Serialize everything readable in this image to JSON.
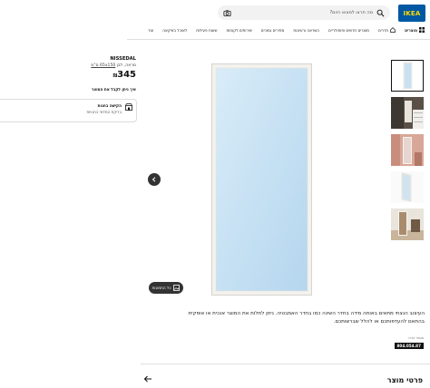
{
  "header": {
    "logo_text": "ΙΚΕΑ",
    "search_placeholder": "מה תרצו למצוא היום?",
    "nav": [
      {
        "label": "מוצרים",
        "icon": "grid-icon"
      },
      {
        "label": "חדרים"
      },
      {
        "label": "מוצרים חדשים ופופולריים"
      },
      {
        "label": "השראה ורעיונות"
      },
      {
        "label": "מחירים נמוכים"
      },
      {
        "label": "שירותים לקוחות"
      },
      {
        "label": "שעות פעילות"
      },
      {
        "label": "לאוכל באיקאה"
      },
      {
        "label": "עוד"
      }
    ]
  },
  "product": {
    "name": "NISSEDAL",
    "description_prefix": "מראה, לבן ",
    "description_size": "65x150 ס\"מ",
    "price": "345",
    "currency": "₪",
    "how_to_get": "איך ניתן לקבל את המוצר",
    "delivery_title": "הקישה בחנות",
    "delivery_sub": "בדיקת המלאי בחנויות",
    "view_button": "כל התמונות",
    "long_description": "העיצוב הנצחי מתאים באותה מידה בחדר השינה כמו בחדר האמבטיה. ניתן לתלות את המוצר אנכית או אופקית בהתאם להעדפותכם או להלל שברשותכם.",
    "article_label": "מספר פריט",
    "article_number": "804.054.87",
    "details_heading": "פרטי מוצר"
  },
  "colors": {
    "brand_blue": "#0058a3",
    "brand_yellow": "#ffdb00"
  }
}
